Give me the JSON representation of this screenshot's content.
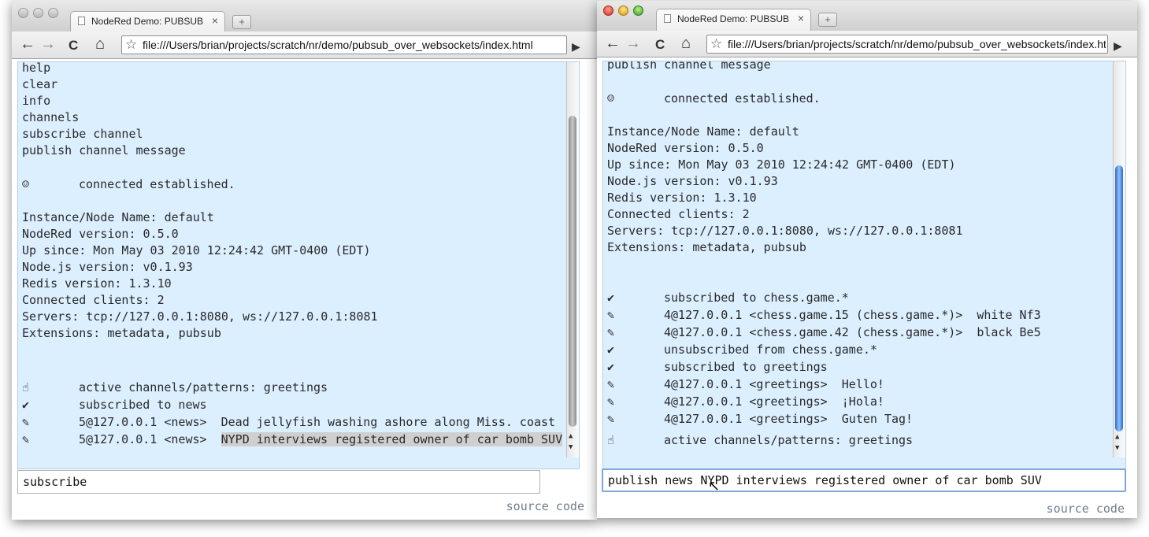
{
  "left_window": {
    "tab_title": "NodeRed Demo: PUBSUB over Websockets",
    "tab_close": "×",
    "newtab": "+",
    "nav": {
      "back": "←",
      "forward": "→",
      "reload": "C",
      "home": "⌂",
      "star": "☆",
      "go": "▶"
    },
    "url": "file:///Users/brian/projects/scratch/nr/demo/pubsub_over_websockets/index.html",
    "console": {
      "plain_lines": [
        "help",
        "clear",
        "info",
        "channels",
        "subscribe channel",
        "publish channel message"
      ],
      "connected": {
        "icon": "☺",
        "text": "connected established."
      },
      "info_lines": [
        "Instance/Node Name: default",
        "NodeRed version: 0.5.0",
        "Up since: Mon May 03 2010 12:24:42 GMT-0400 (EDT)",
        "Node.js version: v0.1.93",
        "Redis version: 1.3.10",
        "Connected clients: 2",
        "Servers: tcp://127.0.0.1:8080, ws://127.0.0.1:8081",
        "Extensions: metadata, pubsub"
      ],
      "events": [
        {
          "icon": "☝",
          "text": "active channels/patterns: greetings"
        },
        {
          "icon": "✔",
          "text": "subscribed to news"
        },
        {
          "icon": "✎",
          "text": "5@127.0.0.1 <news>  Dead jellyfish washing ashore along Miss. coast"
        },
        {
          "icon": "✎",
          "prefix": "5@127.0.0.1 <news>  ",
          "highlight": "NYPD interviews registered owner of car bomb SUV"
        }
      ]
    },
    "command_value": "subscribe",
    "source_link": "source code"
  },
  "right_window": {
    "tab_title": "NodeRed Demo: PUBSUB over Websockets",
    "tab_close": "×",
    "newtab": "+",
    "nav": {
      "back": "←",
      "forward": "→",
      "reload": "C",
      "home": "⌂",
      "star": "☆",
      "go": "▶"
    },
    "url": "file:///Users/brian/projects/scratch/nr/demo/pubsub_over_websockets/index.html",
    "console": {
      "top_partial": "publish channel message",
      "connected": {
        "icon": "☺",
        "text": "connected established."
      },
      "info_lines": [
        "Instance/Node Name: default",
        "NodeRed version: 0.5.0",
        "Up since: Mon May 03 2010 12:24:42 GMT-0400 (EDT)",
        "Node.js version: v0.1.93",
        "Redis version: 1.3.10",
        "Connected clients: 2",
        "Servers: tcp://127.0.0.1:8080, ws://127.0.0.1:8081",
        "Extensions: metadata, pubsub"
      ],
      "events": [
        {
          "icon": "✔",
          "text": "subscribed to chess.game.*"
        },
        {
          "icon": "✎",
          "text": "4@127.0.0.1 <chess.game.15 (chess.game.*)>  white Nf3"
        },
        {
          "icon": "✎",
          "text": "4@127.0.0.1 <chess.game.42 (chess.game.*)>  black Be5"
        },
        {
          "icon": "✔",
          "text": "unsubscribed from chess.game.*"
        },
        {
          "icon": "✔",
          "text": "subscribed to greetings"
        },
        {
          "icon": "✎",
          "text": "4@127.0.0.1 <greetings>  Hello!"
        },
        {
          "icon": "✎",
          "text": "4@127.0.0.1 <greetings>  ¡Hola!"
        },
        {
          "icon": "✎",
          "text": "4@127.0.0.1 <greetings>  Guten Tag!"
        },
        {
          "icon": "☝",
          "text": "active channels/patterns: greetings"
        }
      ]
    },
    "command_value": "publish news NYPD interviews registered owner of car bomb SUV",
    "source_link": "source code"
  }
}
